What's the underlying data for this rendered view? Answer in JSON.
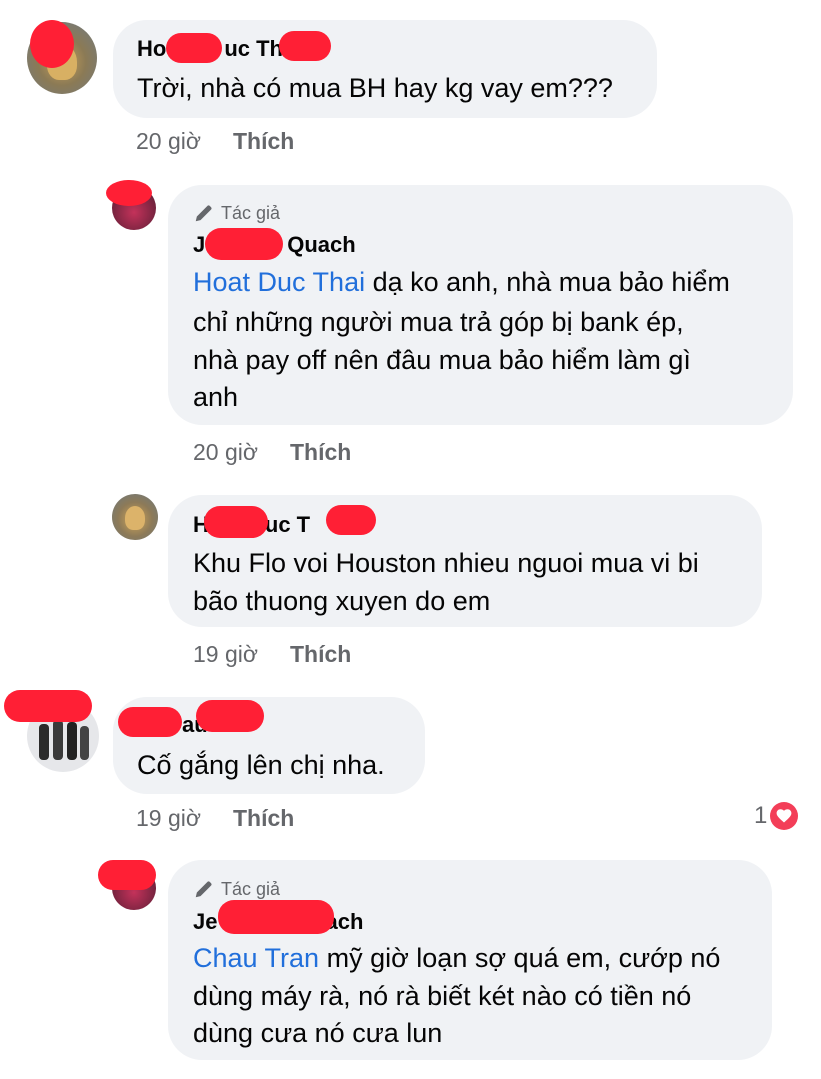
{
  "comments": [
    {
      "name_part1": "Ho",
      "name_part2": "uc Th",
      "lines": [
        "Trời, nhà có mua BH hay kg vay em???"
      ],
      "time": "20 giờ",
      "like": "Thích"
    },
    {
      "author_badge": "Tác giả",
      "name_part1": "J",
      "name_part2": "Quach",
      "mention": "Hoat Duc Thai",
      "lines": [
        " dạ ko anh, nhà mua bảo hiểm",
        "chỉ những người mua trả góp bị bank ép,",
        "nhà pay off nên đâu mua bảo hiểm làm gì",
        "anh"
      ],
      "time": "20 giờ",
      "like": "Thích"
    },
    {
      "name_part1": "H",
      "name_part2": "uc T",
      "lines": [
        "Khu Flo voi Houston nhieu nguoi mua vi bi",
        "bão thuong xuyen do em"
      ],
      "time": "19 giờ",
      "like": "Thích"
    },
    {
      "name_part1": "",
      "name_part2": "au",
      "lines": [
        "Cố gắng lên chị nha."
      ],
      "time": "19 giờ",
      "like": "Thích",
      "reaction_count": "1"
    },
    {
      "author_badge": "Tác giả",
      "name_part1": "Je",
      "name_part2": "ach",
      "mention": "Chau Tran",
      "lines": [
        " mỹ giờ loạn sợ quá em, cướp nó",
        "dùng máy rà, nó rà biết két nào có tiền nó",
        "dùng cưa nó cưa lun"
      ]
    }
  ],
  "colors": {
    "bubble": "#f0f2f5",
    "mention": "#216fdb",
    "meta": "#65676b",
    "redaction": "#ff1f35",
    "heart": "#f33e58"
  }
}
